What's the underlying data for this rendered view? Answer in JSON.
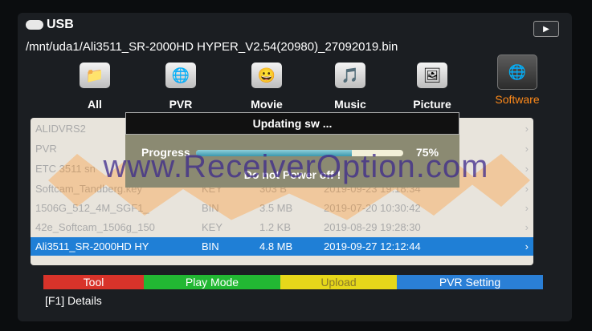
{
  "title": "USB",
  "play_button": "▶",
  "path": "/mnt/uda1/Ali3511_SR-2000HD HYPER_V2.54(20980)_27092019.bin",
  "categories": [
    {
      "label": "All",
      "icon": "folder-icon",
      "glyph": "📁"
    },
    {
      "label": "PVR",
      "icon": "pvr-icon",
      "glyph": "🌐"
    },
    {
      "label": "Movie",
      "icon": "movie-icon",
      "glyph": "😀"
    },
    {
      "label": "Music",
      "icon": "music-icon",
      "glyph": "🎵"
    },
    {
      "label": "Picture",
      "icon": "picture-icon",
      "glyph": "🖼"
    },
    {
      "label": "Software",
      "icon": "software-icon",
      "glyph": "🌐"
    }
  ],
  "files": [
    {
      "name": "ALIDVRS2",
      "type": "",
      "size": "",
      "date": "",
      "arrow": "›"
    },
    {
      "name": "PVR",
      "type": "",
      "size": "",
      "date": "",
      "arrow": "›"
    },
    {
      "name": "ETC 3511 sn",
      "type": "",
      "size": "",
      "date": "",
      "arrow": "›"
    },
    {
      "name": "Softcam_Tandberg.key",
      "type": "KEY",
      "size": "303 B",
      "date": "2019-09-23 19:18:34",
      "arrow": "›"
    },
    {
      "name": "1506G_512_4M_SGF1_",
      "type": "BIN",
      "size": "3.5 MB",
      "date": "2019-07-20 10:30:42",
      "arrow": "›"
    },
    {
      "name": "42e_Softcam_1506g_150",
      "type": "KEY",
      "size": "1.2 KB",
      "date": "2019-08-29 19:28:30",
      "arrow": "›"
    },
    {
      "name": "Ali3511_SR-2000HD HY",
      "type": "BIN",
      "size": "4.8 MB",
      "date": "2019-09-27 12:12:44",
      "arrow": "›"
    }
  ],
  "dialog": {
    "title": "Updating sw ...",
    "progress_label": "Progress",
    "progress_value": 0.75,
    "progress_text": "75%",
    "warning": "Do not Power off !"
  },
  "watermark": "www.ReceiverOption.com",
  "color_keys": [
    {
      "label": "Tool",
      "color": "red"
    },
    {
      "label": "Play Mode",
      "color": "green"
    },
    {
      "label": "Upload",
      "color": "yellow"
    },
    {
      "label": "PVR Setting",
      "color": "blue"
    }
  ],
  "details": "[F1]  Details"
}
